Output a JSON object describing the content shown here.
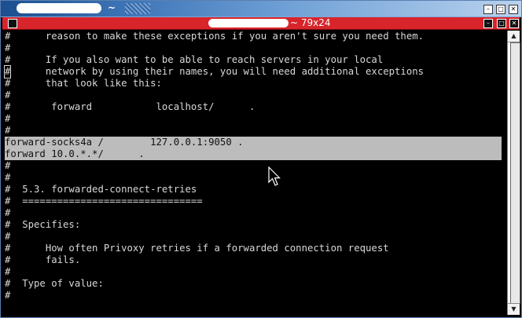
{
  "window": {
    "title_suffix": "~",
    "min_symbol": "–",
    "max_symbol": "□",
    "close_symbol": "✕"
  },
  "terminal": {
    "title_suffix": "~ 79x24",
    "min_symbol": "–",
    "max_symbol": "□",
    "close_symbol": "✕"
  },
  "lines": [
    {
      "text": "#      reason to make these exceptions if you aren't sure you need them.",
      "selected": false
    },
    {
      "text": "#",
      "selected": false
    },
    {
      "text": "#      If you also want to be able to reach servers in your local",
      "selected": false
    },
    {
      "text": "#      network by using their names, you will need additional exceptions",
      "selected": false
    },
    {
      "text": "#      that look like this:",
      "selected": false
    },
    {
      "text": "#",
      "selected": false
    },
    {
      "text": "#       forward           localhost/      .",
      "selected": false
    },
    {
      "text": "#",
      "selected": false
    },
    {
      "text": "#",
      "selected": false
    },
    {
      "text": "forward-socks4a /        127.0.0.1:9050 .",
      "selected": true
    },
    {
      "text": "forward 10.0.*.*/      .",
      "selected": true
    },
    {
      "text": "#",
      "selected": false
    },
    {
      "text": "#",
      "selected": false
    },
    {
      "text": "#  5.3. forwarded-connect-retries",
      "selected": false
    },
    {
      "text": "#  ===============================",
      "selected": false
    },
    {
      "text": "#",
      "selected": false
    },
    {
      "text": "#  Specifies:",
      "selected": false
    },
    {
      "text": "#",
      "selected": false
    },
    {
      "text": "#      How often Privoxy retries if a forwarded connection request",
      "selected": false
    },
    {
      "text": "#      fails.",
      "selected": false
    },
    {
      "text": "#",
      "selected": false
    },
    {
      "text": "#  Type of value:",
      "selected": false
    },
    {
      "text": "#",
      "selected": false
    }
  ],
  "scrollbar": {
    "up_symbol": "▲",
    "down_symbol": "▼",
    "thumb_start_fraction": 0.0,
    "thumb_end_fraction": 1.0
  }
}
